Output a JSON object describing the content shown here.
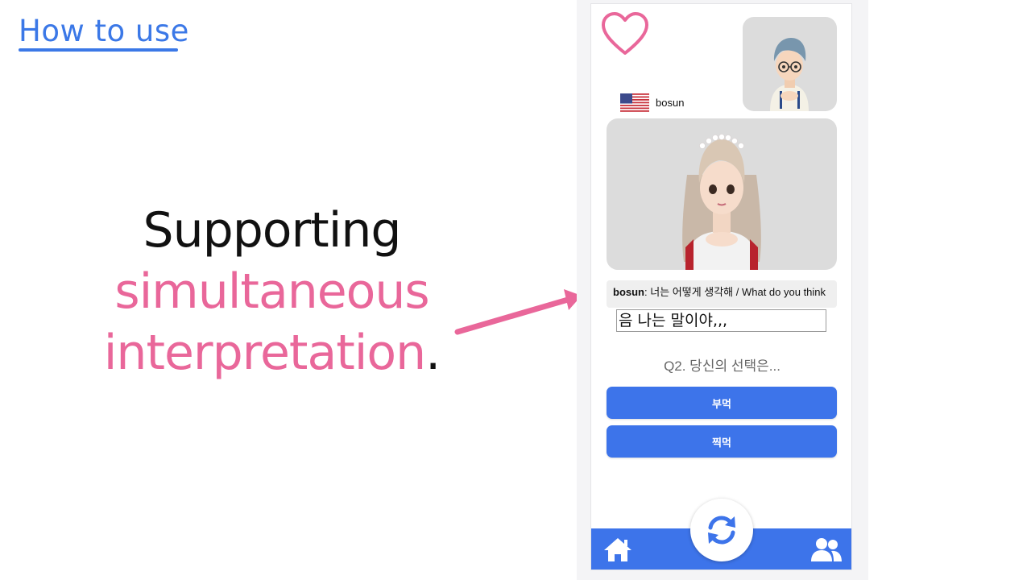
{
  "slide": {
    "title": "How to use",
    "headline_line1": "Supporting",
    "headline_line2": "simultaneous",
    "headline_line3": "interpretation",
    "headline_period": ".",
    "accent_color": "#e9679a",
    "title_color": "#3b78e7"
  },
  "app": {
    "username": "bosun",
    "flag_icon": "us-flag-icon",
    "chat": {
      "speaker": "bosun",
      "separator": ":",
      "message": " 너는 어떻게 생각해 / What do you think"
    },
    "input_value": "음 나는 말이야,,,",
    "question": "Q2. 당신의 선택은...",
    "choices": [
      "부먹",
      "찍먹"
    ],
    "brand_color": "#3d74ea",
    "nav": {
      "home_icon": "home-icon",
      "refresh_icon": "refresh-icon",
      "friends_icon": "people-icon"
    }
  }
}
